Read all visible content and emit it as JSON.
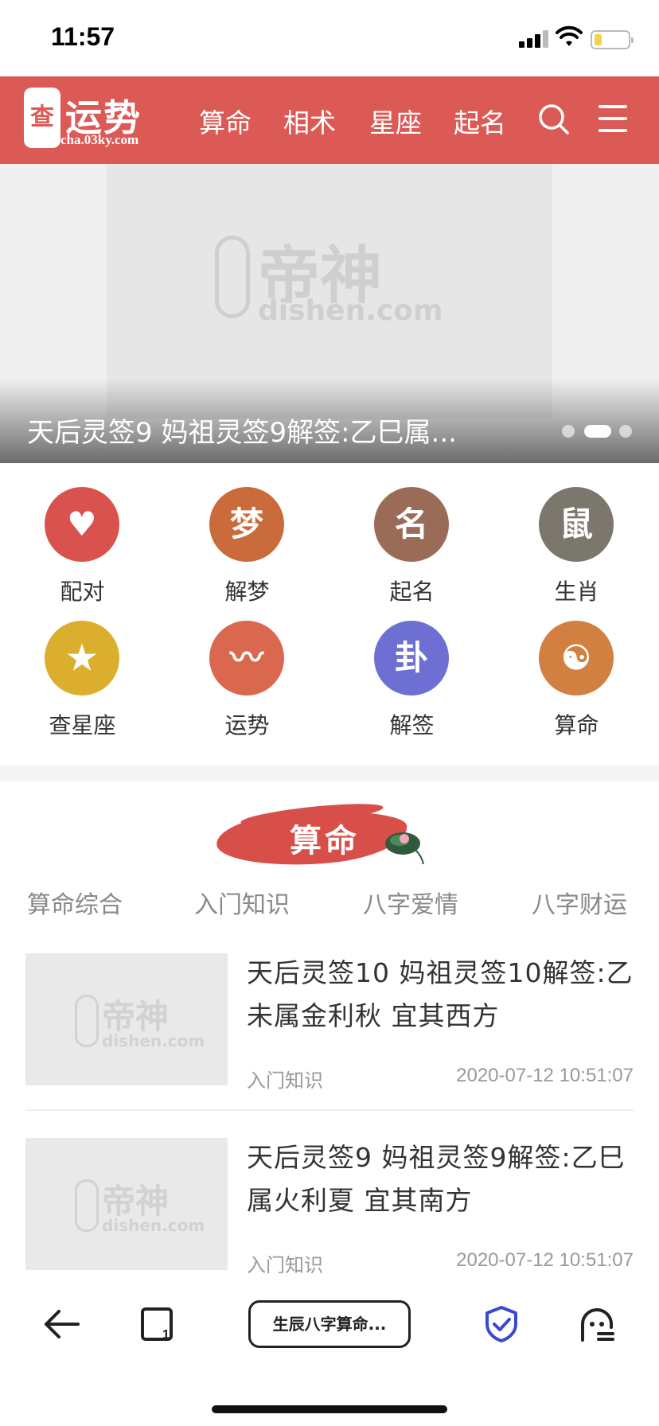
{
  "status": {
    "time": "11:57"
  },
  "header": {
    "logo_seal": "查",
    "logo_title": "运势",
    "logo_url": "cha.03ky.com",
    "nav": [
      "算命",
      "相术",
      "星座",
      "起名"
    ]
  },
  "banner": {
    "caption": "天后灵签9 妈祖灵签9解签:乙巳属...",
    "watermark": {
      "name": "帝神",
      "url": "dishen.com"
    },
    "active_slide": 2,
    "slide_count": 3
  },
  "grid": [
    {
      "label": "配对",
      "icon": "heart-pair-icon",
      "color": "#d9524e",
      "glyph": "♥"
    },
    {
      "label": "解梦",
      "icon": "dream-icon",
      "color": "#c96b3a",
      "glyph": "梦"
    },
    {
      "label": "起名",
      "icon": "naming-icon",
      "color": "#9a6c58",
      "glyph": "名"
    },
    {
      "label": "生肖",
      "icon": "zodiac-rat-icon",
      "color": "#7c776c",
      "glyph": "鼠"
    },
    {
      "label": "查星座",
      "icon": "star-search-icon",
      "color": "#dcae2e",
      "glyph": "★"
    },
    {
      "label": "运势",
      "icon": "fortune-pulse-icon",
      "color": "#d9684e",
      "glyph": "〰"
    },
    {
      "label": "解签",
      "icon": "lottery-stick-icon",
      "color": "#6d6fd2",
      "glyph": "卦"
    },
    {
      "label": "算命",
      "icon": "yin-yang-icon",
      "color": "#d28042",
      "glyph": "☯"
    }
  ],
  "section": {
    "title": "算命",
    "tabs": [
      "算命综合",
      "入门知识",
      "八字爱情",
      "八字财运"
    ]
  },
  "articles": [
    {
      "title": "天后灵签10 妈祖灵签10解签:乙未属金利秋 宜其西方",
      "category": "入门知识",
      "date": "2020-07-12 10:51:07"
    },
    {
      "title": "天后灵签9 妈祖灵签9解签:乙巳属火利夏 宜其南方",
      "category": "入门知识",
      "date": "2020-07-12 10:51:07"
    }
  ],
  "toolbar": {
    "url_label": "生辰八字算命..."
  },
  "colors": {
    "brand": "#dc5a56",
    "shield": "#3b47d6"
  }
}
